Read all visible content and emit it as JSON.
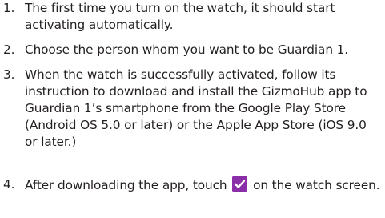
{
  "steps": [
    {
      "number": "1.",
      "text": "The first time you turn on the watch, it should start activating automatically."
    },
    {
      "number": "2.",
      "text": "Choose the person whom you want to be Guardian 1."
    },
    {
      "number": "3.",
      "text": "When the watch is successfully activated, follow its instruction to download and install the GizmoHub app to Guardian 1’s smartphone from the Google Play Store (Android OS 5.0 or later) or the Apple App Store (iOS 9.0 or later.)"
    },
    {
      "number": "4.",
      "text_before": "After downloading the app, touch",
      "icon": "check-icon",
      "text_after": "on the watch screen."
    }
  ],
  "colors": {
    "text": "#231f20",
    "check_icon_bg": "#8b2fa8"
  }
}
